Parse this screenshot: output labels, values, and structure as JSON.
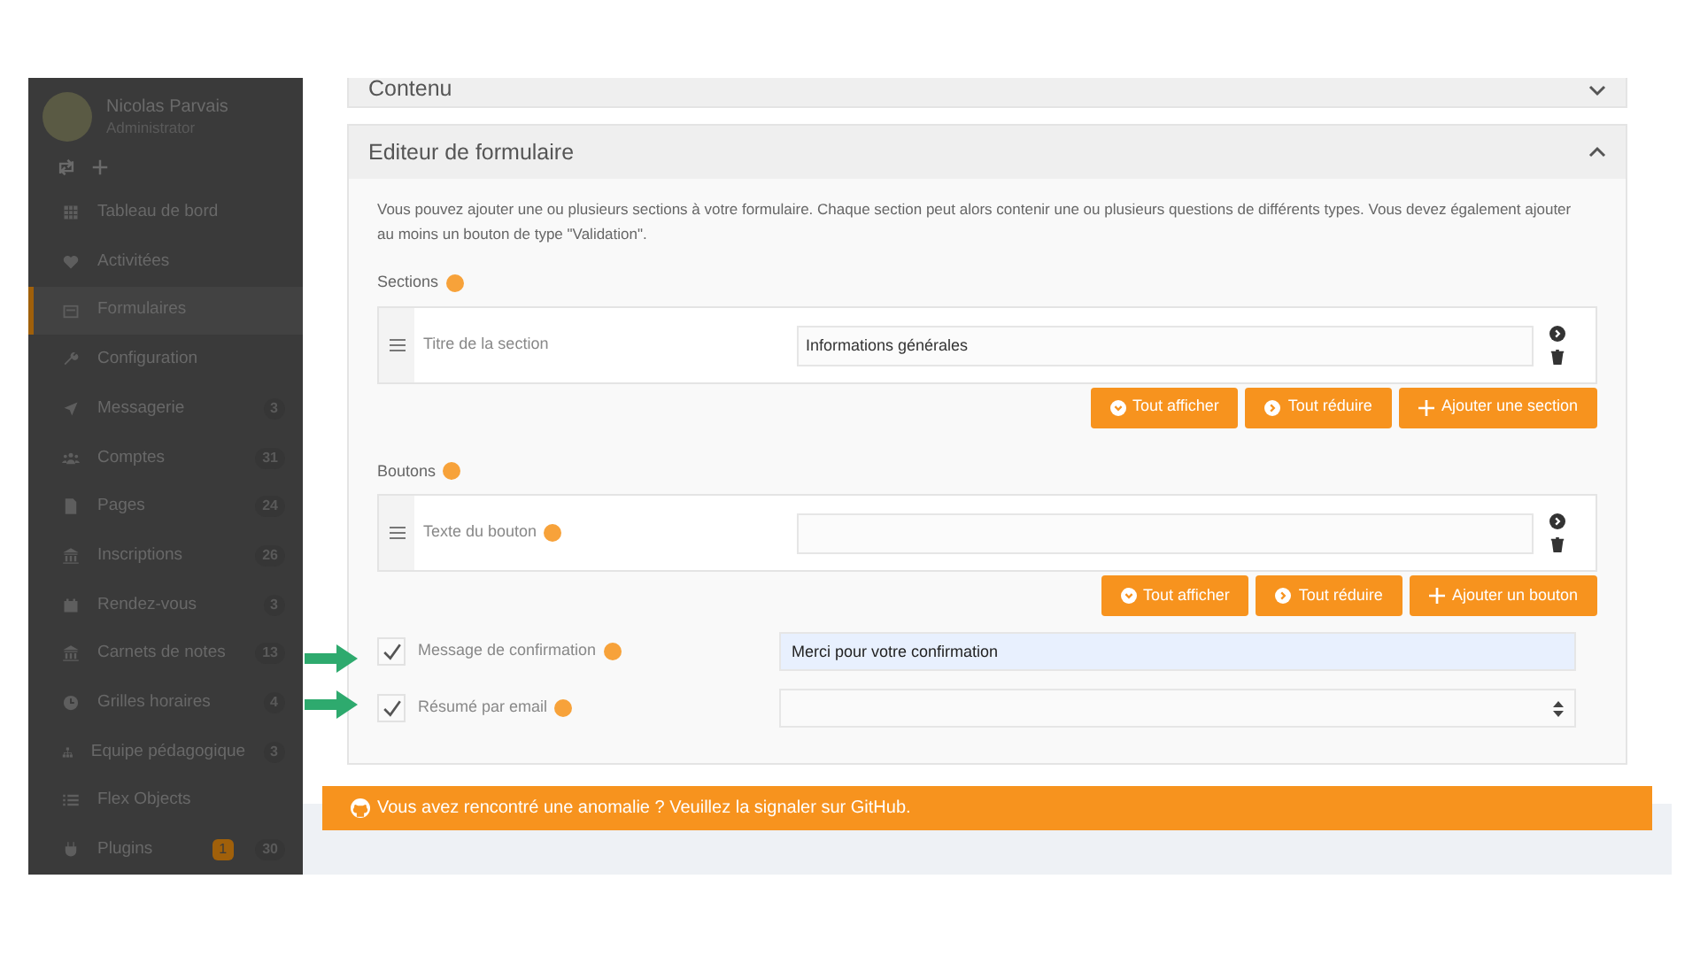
{
  "sidebar": {
    "user": {
      "name": "Nicolas Parvais",
      "role": "Administrator"
    },
    "items": [
      {
        "label": "Tableau de bord",
        "selected": false
      },
      {
        "label": "Activitées",
        "selected": false
      },
      {
        "label": "Formulaires",
        "selected": true
      },
      {
        "label": "Configuration",
        "selected": false
      },
      {
        "label": "Messagerie",
        "count": "3",
        "selected": false
      },
      {
        "label": "Comptes",
        "count": "31",
        "selected": false
      },
      {
        "label": "Pages",
        "count": "24",
        "selected": false
      },
      {
        "label": "Inscriptions",
        "count": "26",
        "selected": false
      },
      {
        "label": "Rendez-vous",
        "count": "3",
        "selected": false
      },
      {
        "label": "Carnets de notes",
        "count": "13",
        "selected": false
      },
      {
        "label": "Grilles horaires",
        "count": "4",
        "selected": false
      },
      {
        "label": "Equipe pédagogique",
        "count": "3",
        "selected": false
      },
      {
        "label": "Flex Objects",
        "selected": false
      },
      {
        "label": "Plugins",
        "alert": "1",
        "count": "30",
        "selected": false
      }
    ]
  },
  "panels": [
    {
      "title": "Contenu",
      "expanded": false
    },
    {
      "title": "Editeur de formulaire",
      "expanded": true
    }
  ],
  "editor": {
    "description": "Vous pouvez ajouter une ou plusieurs sections à votre formulaire. Chaque section peut alors contenir une ou plusieurs questions de différents types. Vous devez également ajouter au moins un bouton de type \"Validation\".",
    "groups": [
      {
        "label": "Sections",
        "row_label": "Titre de la section",
        "row_help": false,
        "value": "Informations générales",
        "buttons": [
          "Tout afficher",
          "Tout réduire",
          "Ajouter une section"
        ]
      },
      {
        "label": "Boutons",
        "row_label": "Texte du bouton",
        "row_help": true,
        "buttons": [
          "Tout afficher",
          "Tout réduire",
          "Ajouter un bouton"
        ]
      }
    ],
    "options": [
      {
        "kind": "text",
        "label": "Message de confirmation",
        "checked": true,
        "value": "Merci pour votre confirmation"
      },
      {
        "kind": "select",
        "label": "Résumé par email",
        "checked": true
      }
    ]
  },
  "footer": {
    "text": "Vous avez rencontré une anomalie ? Veuillez la signaler sur GitHub."
  }
}
